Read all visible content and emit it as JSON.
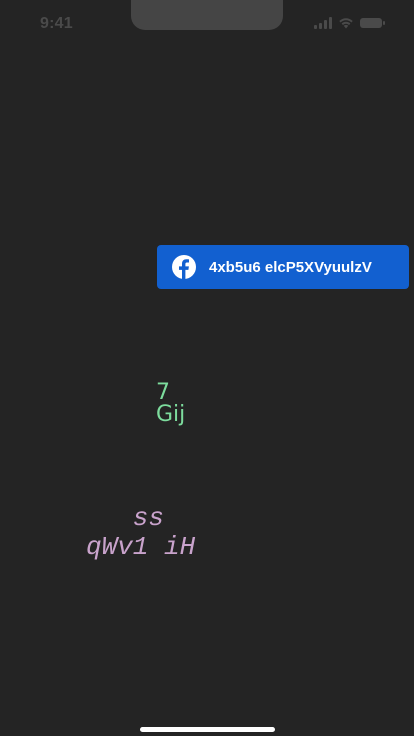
{
  "status_bar": {
    "time": "9:41",
    "icons": [
      "cellular-signal-icon",
      "wifi-icon",
      "battery-icon"
    ]
  },
  "facebook_button": {
    "label": "4xb5u6 elcP5XVyuulzV",
    "icon": "facebook-icon",
    "color": "#1260d0"
  },
  "green_text": {
    "line1": "7",
    "line2": "Gij",
    "color": "#7ddc9d"
  },
  "mono_text": {
    "line1": "   ss",
    "line2": "qWv1 iH",
    "color": "#c9a3cc"
  },
  "colors": {
    "background": "#242424",
    "home_indicator": "#ffffff"
  }
}
